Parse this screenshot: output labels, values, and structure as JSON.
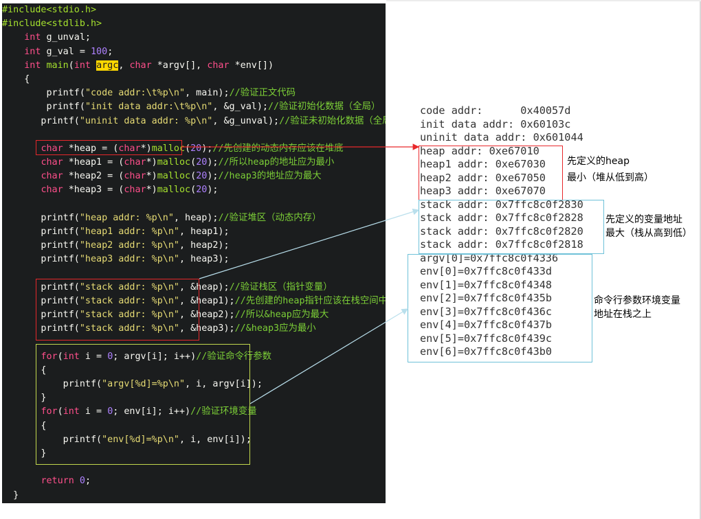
{
  "code_lines": [
    "#include<stdio.h>",
    "#include<stdlib.h>",
    "    int g_unval;",
    "    int g_val = 100;",
    "    int main(int argc, char *argv[], char *env[])",
    "    {",
    "        printf(\"code addr:\\t%p\\n\", main);//验证正文代码",
    "        printf(\"init data addr:\\t%p\\n\", &g_val);//验证初始化数据（全局）",
    "       printf(\"uninit data addr: %p\\n\", &g_unval);//验证未初始化数据（全局）",
    "",
    "       char *heap = (char*)malloc(20);//先创建的动态内存应该在堆底",
    "       char *heap1 = (char*)malloc(20);//所以heap的地址应为最小",
    "       char *heap2 = (char*)malloc(20);//heap3的地址应为最大",
    "       char *heap3 = (char*)malloc(20);",
    "",
    "       printf(\"heap addr: %p\\n\", heap);//验证堆区（动态内存）",
    "       printf(\"heap1 addr: %p\\n\", heap1);",
    "       printf(\"heap2 addr: %p\\n\", heap2);",
    "       printf(\"heap3 addr: %p\\n\", heap3);",
    "",
    "       printf(\"stack addr: %p\\n\", &heap);//验证栈区（指针变量）",
    "       printf(\"stack addr: %p\\n\", &heap1);//先创建的heap指针应该在栈空间中地址最大",
    "       printf(\"stack addr: %p\\n\", &heap2);//所以&heap应为最大",
    "       printf(\"stack addr: %p\\n\", &heap3);//&heap3应为最小",
    "",
    "       for(int i = 0; argv[i]; i++)//验证命令行参数",
    "       {",
    "           printf(\"argv[%d]=%p\\n\", i, argv[i]);",
    "       }",
    "       for(int i = 0; env[i]; i++)//验证环境变量",
    "       {",
    "           printf(\"env[%d]=%p\\n\", i, env[i]);",
    "       }",
    "",
    "       return 0;",
    "  }"
  ],
  "output_lines": [
    "code addr:      0x40057d",
    "init data addr: 0x60103c",
    "uninit data addr: 0x601044",
    "heap addr: 0xe67010",
    "heap1 addr: 0xe67030",
    "heap2 addr: 0xe67050",
    "heap3 addr: 0xe67070",
    "stack addr: 0x7ffc8c0f2830",
    "stack addr: 0x7ffc8c0f2828",
    "stack addr: 0x7ffc8c0f2820",
    "stack addr: 0x7ffc8c0f2818",
    "argv[0]=0x7ffc8c0f4336",
    "env[0]=0x7ffc8c0f433d",
    "env[1]=0x7ffc8c0f4348",
    "env[2]=0x7ffc8c0f435b",
    "env[3]=0x7ffc8c0f436c",
    "env[4]=0x7ffc8c0f437b",
    "env[5]=0x7ffc8c0f439c",
    "env[6]=0x7ffc8c0f43b0"
  ],
  "notes": {
    "heap_line1": "先定义的heap",
    "heap_line2": "最小（堆从低到高）",
    "stack_line1": "先定义的变量地址",
    "stack_line2": "最大（栈从高到低）",
    "env_line1": "命令行参数环境变量",
    "env_line2": "地址在栈之上"
  },
  "colors": {
    "editor_bg": "#1b1d1e",
    "heap_box": "#e8282b",
    "stack_box": "#6ec1d8",
    "env_box": "#c3d94e"
  }
}
